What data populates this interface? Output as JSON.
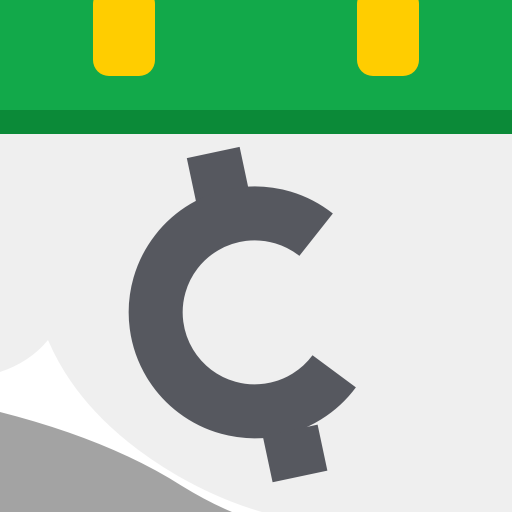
{
  "app_icon": {
    "name": "calendar-cent-app-icon",
    "colors": {
      "header_green": "#12a94a",
      "header_shadow": "#0b8a38",
      "ring_yellow": "#ffcd00",
      "page_light": "#efefef",
      "page_white": "#ffffff",
      "curl_gray": "#a3a3a3",
      "glyph_gray": "#56585f"
    },
    "icons": [
      "calendar-binder-ring-icon",
      "cent-sign-icon",
      "page-curl-icon"
    ]
  }
}
